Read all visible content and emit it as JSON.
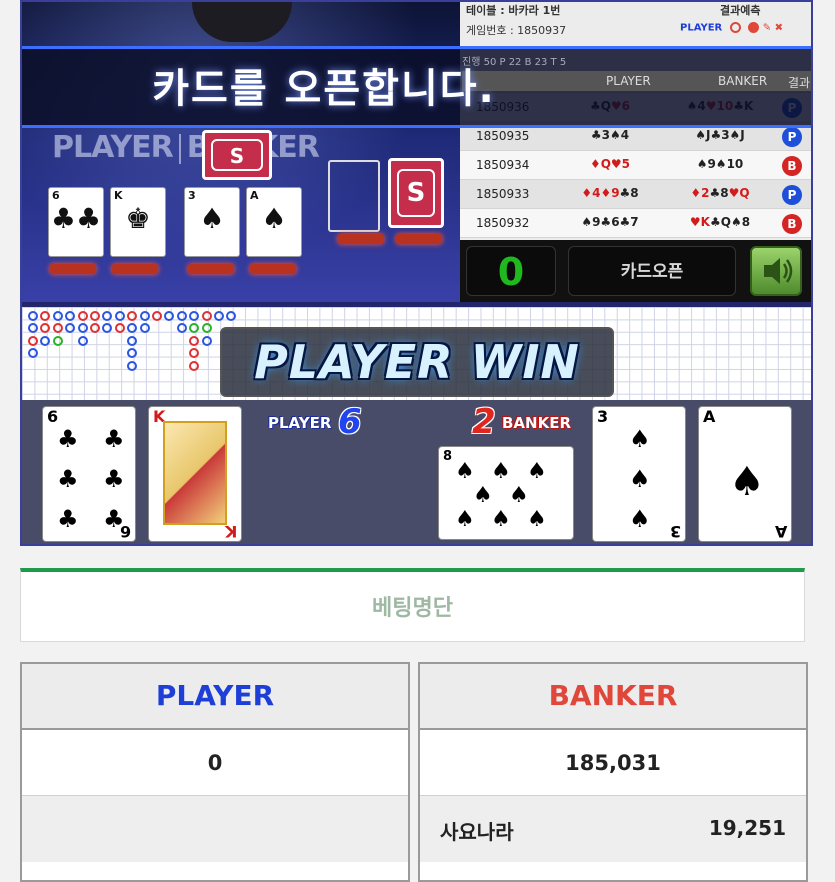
{
  "table_info": {
    "table_label": "테이블 : 바카라 1번",
    "game_no_label": "게임번호 : 1850937",
    "round_stats": "진행 50   P 22   B 23   T 5",
    "prediction_title": "결과예측",
    "prediction_player": "PLAYER",
    "prediction_banker": "BANKER"
  },
  "overlay_message": "카드를 오픈합니다.",
  "table_logo": {
    "left": "PLAYER",
    "right": "BANKER"
  },
  "history": {
    "columns": [
      "PLAYER",
      "BANKER",
      "결과"
    ],
    "rows": [
      {
        "id": "1850936",
        "player": "♣Q♥6",
        "banker": "♠4♥10♣K",
        "result": "P"
      },
      {
        "id": "1850935",
        "player": "♣3♠4",
        "banker": "♠J♣3♠J",
        "result": "P"
      },
      {
        "id": "1850934",
        "player": "♦Q♥5",
        "banker": "♠9♠10",
        "result": "B"
      },
      {
        "id": "1850933",
        "player": "♦4♦9♣8",
        "banker": "♦2♣8♥Q",
        "result": "P"
      },
      {
        "id": "1850932",
        "player": "♠9♣6♣7",
        "banker": "♥K♣Q♠8",
        "result": "B"
      }
    ]
  },
  "controls": {
    "counter": "0",
    "open_button": "카드오픈",
    "sound_icon": "speaker-icon"
  },
  "win_banner": "PLAYER WIN",
  "result": {
    "player_label": "PLAYER",
    "player_score": "6",
    "banker_label": "BANKER",
    "banker_score": "2",
    "player_cards": [
      {
        "rank": "6",
        "suit": "♣"
      },
      {
        "rank": "K",
        "suit": "♥"
      }
    ],
    "banker_cards": [
      {
        "rank": "8",
        "suit": "♠"
      },
      {
        "rank": "3",
        "suit": "♠"
      },
      {
        "rank": "A",
        "suit": "♠"
      }
    ]
  },
  "bet_list": {
    "title": "베팅명단",
    "player": {
      "label": "PLAYER",
      "total": "0"
    },
    "banker": {
      "label": "BANKER",
      "total": "185,031",
      "entries": [
        {
          "name": "사요나라",
          "amount": "19,251"
        }
      ]
    }
  },
  "colors": {
    "player": "#1d3fd8",
    "banker": "#e0473a",
    "accent_green": "#1f9a4a"
  }
}
